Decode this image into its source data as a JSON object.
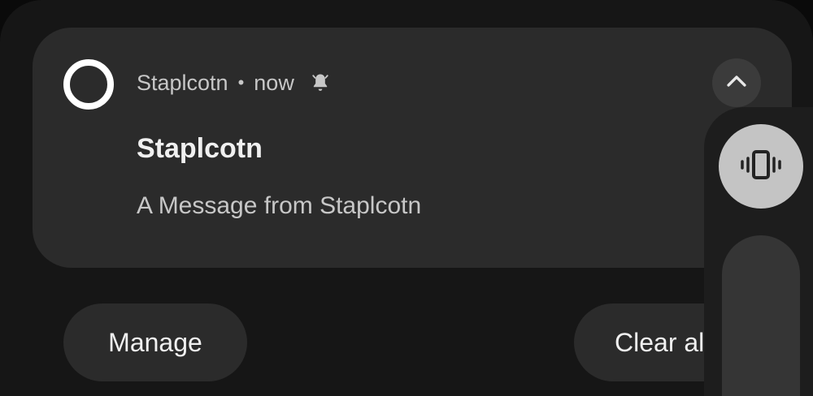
{
  "notification": {
    "app_name": "Staplcotn",
    "separator": "•",
    "time": "now",
    "title": "Staplcotn",
    "message": "A Message from Staplcotn",
    "app_icon": "ring-app-icon",
    "alert_icon": "bell-icon",
    "expand_icon": "chevron-up-icon"
  },
  "actions": {
    "manage_label": "Manage",
    "clear_all_label": "Clear all"
  },
  "volume_panel": {
    "ringer_mode": "vibrate",
    "ringer_icon": "vibrate-icon"
  },
  "colors": {
    "background": "#161616",
    "card": "#2b2b2b",
    "text_primary": "#f0f0f0",
    "text_secondary": "#c7c7c7",
    "ringer_button": "#c4c4c4"
  }
}
